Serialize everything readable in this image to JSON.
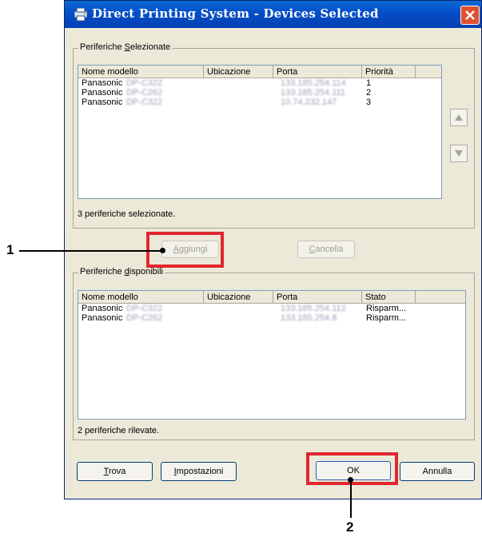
{
  "window": {
    "title": "Direct Printing System - Devices Selected"
  },
  "selected_group": {
    "legend_pre": "Periferiche ",
    "legend_key": "S",
    "legend_post": "elezionate",
    "columns": [
      "Nome modello",
      "Ubicazione",
      "Porta",
      "Priorità"
    ],
    "rows": [
      {
        "name": "Panasonic",
        "model": "DP-C322",
        "location": "",
        "port": "133.185.254.114",
        "priority": "1"
      },
      {
        "name": "Panasonic",
        "model": "DP-C262",
        "location": "",
        "port": "133.185.254.111",
        "priority": "2"
      },
      {
        "name": "Panasonic",
        "model": "DP-C322",
        "location": "",
        "port": "10.74.232.147",
        "priority": "3"
      }
    ],
    "status": "3 periferiche selezionate."
  },
  "buttons": {
    "add_key": "A",
    "add_rest": "ggiungi",
    "remove_key": "C",
    "remove_rest": "ancella",
    "find_key": "T",
    "find_rest": "rova",
    "settings_key": "I",
    "settings_rest": "mpostazioni",
    "ok_label": "OK",
    "cancel_label": "Annulla"
  },
  "available_group": {
    "legend_pre": "Periferiche ",
    "legend_key": "d",
    "legend_post": "isponibili",
    "columns": [
      "Nome modello",
      "Ubicazione",
      "Porta",
      "Stato"
    ],
    "rows": [
      {
        "name": "Panasonic",
        "model": "DP-C322",
        "location": "",
        "port": "133.185.254.112",
        "state": "Risparm..."
      },
      {
        "name": "Panasonic",
        "model": "DP-C262",
        "location": "",
        "port": "133.185.254.8",
        "state": "Risparm..."
      }
    ],
    "status": "2 periferiche rilevate."
  },
  "callouts": {
    "one": "1",
    "two": "2"
  },
  "icons": {
    "app": "printer-app-icon",
    "close": "close-icon",
    "up": "arrow-up-icon",
    "down": "arrow-down-icon"
  },
  "colors": {
    "titlebar": "#0450c8",
    "highlight": "#e1262d",
    "dialog_bg": "#ece9d8"
  }
}
